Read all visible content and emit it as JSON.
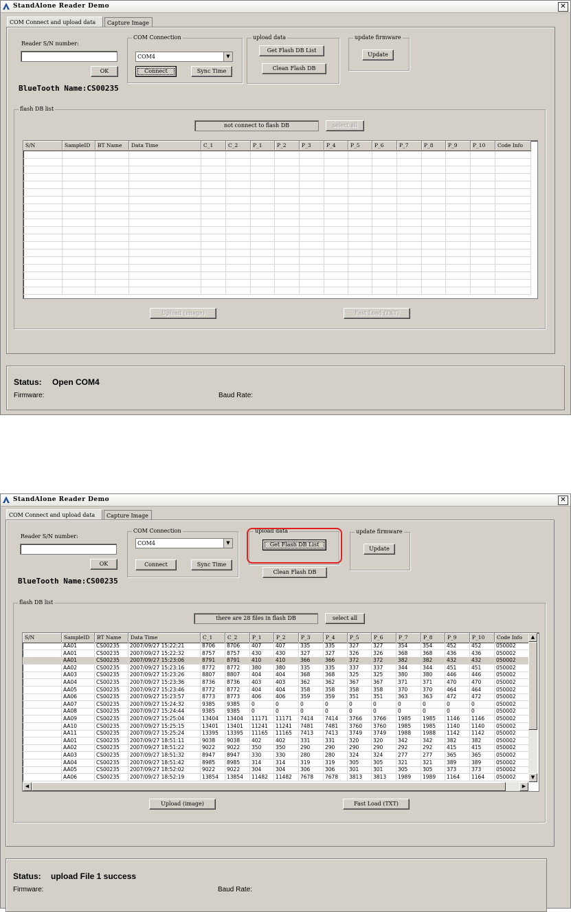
{
  "window_title": "StandAlone Reader Demo",
  "close_glyph": "✕",
  "tabs": [
    "COM Connect and upload data",
    "Capture Image"
  ],
  "reader_label": "Reader S/N number:",
  "ok_label": "OK",
  "com_group": "COM Connection",
  "com_port": "COM4",
  "connect_label": "Connect",
  "sync_label": "Sync Time",
  "upload_group": "upload data",
  "get_flash_label": "Get Flash DB List",
  "clean_flash_label": "Clean Flash DB",
  "firmware_group": "update firmware",
  "update_label": "Update",
  "bluetooth_name": "BlueTooth Name:CS00235",
  "flash_group": "flash DB list",
  "select_all_label": "select all",
  "upload_image_label": "Upload (image)",
  "fast_load_label": "Fast Load (TXT)",
  "firmware_label": "Firmware:",
  "baud_label": "Baud Rate:",
  "columns": [
    "S/N",
    "SampleID",
    "BT Name",
    "Data Time",
    "C_1",
    "C_2",
    "P_1",
    "P_2",
    "P_3",
    "P_4",
    "P_5",
    "P_6",
    "P_7",
    "P_8",
    "P_9",
    "P_10",
    "Code Info"
  ],
  "screen1": {
    "flash_status": "not connect to flash DB",
    "status_label": "Status:",
    "status_value": "Open COM4"
  },
  "screen2": {
    "flash_status": "there are 28 files in flash DB",
    "status_label": "Status:",
    "status_value": "upload File 1 success",
    "rows": [
      [
        "",
        "AA01",
        "CS00235",
        "2007/09/27 15:22:21",
        "8706",
        "8706",
        "407",
        "407",
        "335",
        "335",
        "327",
        "327",
        "354",
        "354",
        "452",
        "452",
        "050002"
      ],
      [
        "",
        "AA01",
        "CS00235",
        "2007/09/27 15:22:32",
        "8757",
        "8757",
        "430",
        "430",
        "327",
        "327",
        "326",
        "326",
        "368",
        "368",
        "436",
        "436",
        "050002"
      ],
      [
        "",
        "AA01",
        "CS00235",
        "2007/09/27 15:23:06",
        "8791",
        "8791",
        "410",
        "410",
        "366",
        "366",
        "372",
        "372",
        "382",
        "382",
        "432",
        "432",
        "050002"
      ],
      [
        "",
        "AA02",
        "CS00235",
        "2007/09/27 15:23:16",
        "8772",
        "8772",
        "380",
        "380",
        "335",
        "335",
        "337",
        "337",
        "344",
        "344",
        "451",
        "451",
        "050002"
      ],
      [
        "",
        "AA03",
        "CS00235",
        "2007/09/27 15:23:26",
        "8807",
        "8807",
        "404",
        "404",
        "368",
        "368",
        "325",
        "325",
        "380",
        "380",
        "446",
        "446",
        "050002"
      ],
      [
        "",
        "AA04",
        "CS00235",
        "2007/09/27 15:23:36",
        "8736",
        "8736",
        "403",
        "403",
        "362",
        "362",
        "367",
        "367",
        "371",
        "371",
        "470",
        "470",
        "050002"
      ],
      [
        "",
        "AA05",
        "CS00235",
        "2007/09/27 15:23:46",
        "8772",
        "8772",
        "404",
        "404",
        "358",
        "358",
        "358",
        "358",
        "370",
        "370",
        "464",
        "464",
        "050002"
      ],
      [
        "",
        "AA06",
        "CS00235",
        "2007/09/27 15:23:57",
        "8773",
        "8773",
        "406",
        "406",
        "359",
        "359",
        "351",
        "351",
        "363",
        "363",
        "472",
        "472",
        "050002"
      ],
      [
        "",
        "AA07",
        "CS00235",
        "2007/09/27 15:24:32",
        "9385",
        "9385",
        "0",
        "0",
        "0",
        "0",
        "0",
        "0",
        "0",
        "0",
        "0",
        "0",
        "050002"
      ],
      [
        "",
        "AA08",
        "CS00235",
        "2007/09/27 15:24:44",
        "9385",
        "9385",
        "0",
        "0",
        "0",
        "0",
        "0",
        "0",
        "0",
        "0",
        "0",
        "0",
        "050002"
      ],
      [
        "",
        "AA09",
        "CS00235",
        "2007/09/27 15:25:04",
        "13404",
        "13404",
        "11171",
        "11171",
        "7414",
        "7414",
        "3766",
        "3766",
        "1985",
        "1985",
        "1146",
        "1146",
        "050002"
      ],
      [
        "",
        "AA10",
        "CS00235",
        "2007/09/27 15:25:15",
        "13401",
        "13401",
        "11241",
        "11241",
        "7481",
        "7481",
        "3760",
        "3760",
        "1985",
        "1985",
        "1140",
        "1140",
        "050002"
      ],
      [
        "",
        "AA11",
        "CS00235",
        "2007/09/27 15:25:24",
        "13395",
        "13395",
        "11165",
        "11165",
        "7413",
        "7413",
        "3749",
        "3749",
        "1988",
        "1988",
        "1142",
        "1142",
        "050002"
      ],
      [
        "",
        "AA01",
        "CS00235",
        "2007/09/27 18:51:11",
        "9038",
        "9038",
        "402",
        "402",
        "331",
        "331",
        "320",
        "320",
        "342",
        "342",
        "382",
        "382",
        "050002"
      ],
      [
        "",
        "AA02",
        "CS00235",
        "2007/09/27 18:51:22",
        "9022",
        "9022",
        "350",
        "350",
        "290",
        "290",
        "290",
        "290",
        "292",
        "292",
        "415",
        "415",
        "050002"
      ],
      [
        "",
        "AA03",
        "CS00235",
        "2007/09/27 18:51:32",
        "8947",
        "8947",
        "330",
        "330",
        "280",
        "280",
        "324",
        "324",
        "277",
        "277",
        "365",
        "365",
        "050002"
      ],
      [
        "",
        "AA04",
        "CS00235",
        "2007/09/27 18:51:42",
        "8985",
        "8985",
        "314",
        "314",
        "319",
        "319",
        "305",
        "305",
        "321",
        "321",
        "389",
        "389",
        "050002"
      ],
      [
        "",
        "AA05",
        "CS00235",
        "2007/09/27 18:52:02",
        "9022",
        "9022",
        "304",
        "304",
        "306",
        "306",
        "301",
        "301",
        "305",
        "305",
        "373",
        "373",
        "050002"
      ],
      [
        "",
        "AA06",
        "CS00235",
        "2007/09/27 18:52:19",
        "13854",
        "13854",
        "11482",
        "11482",
        "7678",
        "7678",
        "3813",
        "3813",
        "1989",
        "1989",
        "1164",
        "1164",
        "050002"
      ]
    ]
  },
  "colors": {
    "window_bg": "#d4d0c8",
    "highlight": "#e02020"
  }
}
